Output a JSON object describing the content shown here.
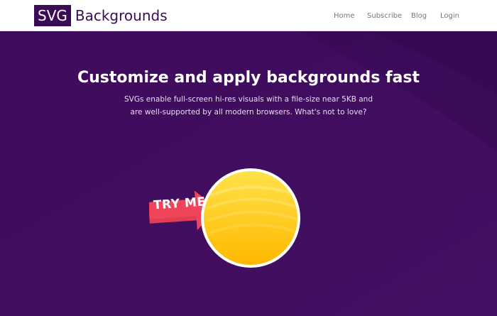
{
  "header": {
    "logo_box": "SVG",
    "logo_text": "Backgrounds",
    "nav": [
      "Home",
      "Subscribe",
      "Blog",
      "Login"
    ]
  },
  "hero": {
    "title": "Customize and apply backgrounds fast",
    "subtitle_line1": "SVGs enable full-screen hi-res visuals with a file-size near 5KB and",
    "subtitle_line2": "are well-supported by all modern browsers. What's not to love?",
    "cta_label": "TRY ME"
  },
  "colors": {
    "header_bg": "#ffffff",
    "brand_purple": "#3b0b56",
    "hero_bg": "#3f0c5c",
    "orb_yellow": "#ffcc1f",
    "arrow_red": "#f0445a"
  },
  "icons": {
    "arrow": "arrow-right-icon",
    "orb": "yellow-orb-icon"
  }
}
